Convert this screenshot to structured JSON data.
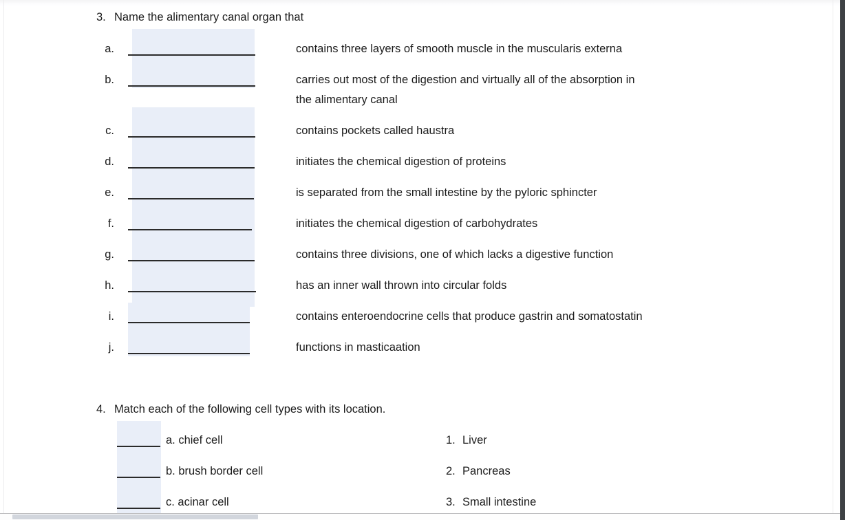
{
  "document": {
    "questions": [
      {
        "number": "3.",
        "prompt": "Name the alimentary canal organ that",
        "items": [
          {
            "letter": "a.",
            "description": "contains three layers of smooth muscle in the muscularis externa"
          },
          {
            "letter": "b.",
            "description": "carries out most of the digestion and virtually all of the absorption in",
            "description_line2": "the alimentary canal"
          },
          {
            "letter": "c.",
            "description": "contains pockets called haustra"
          },
          {
            "letter": "d.",
            "description": "initiates the chemical digestion of proteins"
          },
          {
            "letter": "e.",
            "description": "is separated from the small intestine by the pyloric sphincter"
          },
          {
            "letter": "f.",
            "description": "initiates the chemical digestion of carbohydrates"
          },
          {
            "letter": "g.",
            "description": "contains three divisions, one of which lacks a digestive function"
          },
          {
            "letter": "h.",
            "description": "has an inner wall thrown into circular folds"
          },
          {
            "letter": "i.",
            "description": "contains enteroendocrine cells that produce gastrin and somatostatin"
          },
          {
            "letter": "j.",
            "description": "functions in masticaation"
          }
        ]
      },
      {
        "number": "4.",
        "prompt": "Match each of the following cell types with its location.",
        "cell_types": [
          {
            "letter": "a.",
            "label": "a. chief cell"
          },
          {
            "letter": "b.",
            "label": "b. brush border cell"
          },
          {
            "letter": "c.",
            "label": "c. acinar cell"
          }
        ],
        "locations": [
          {
            "number": "1.",
            "label": "Liver"
          },
          {
            "number": "2.",
            "label": "Pancreas"
          },
          {
            "number": "3.",
            "label": "Small intestine"
          }
        ]
      }
    ]
  },
  "colors": {
    "answer_highlight": "#e9eef8",
    "text": "#1b1b1b",
    "rule": "#2a2a2a",
    "right_gutter": "#3e4144",
    "scroll_thumb": "#d2d6dd"
  }
}
